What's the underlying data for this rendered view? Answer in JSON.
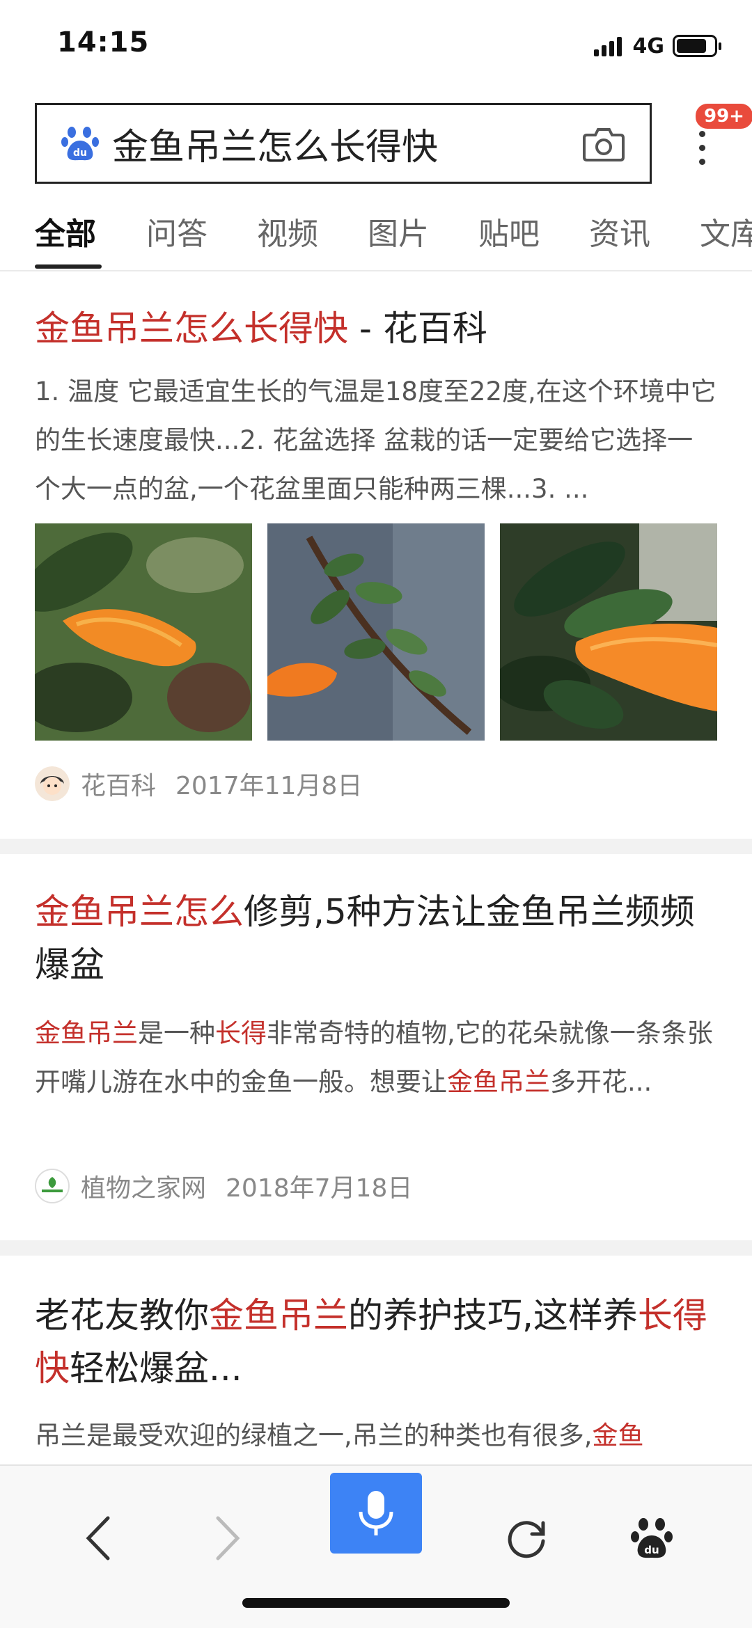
{
  "status": {
    "time": "14:15",
    "network": "4G"
  },
  "search": {
    "query": "金鱼吊兰怎么长得快",
    "badge": "99+"
  },
  "tabs": [
    {
      "label": "全部",
      "active": true
    },
    {
      "label": "问答"
    },
    {
      "label": "视频"
    },
    {
      "label": "图片"
    },
    {
      "label": "贴吧"
    },
    {
      "label": "资讯"
    },
    {
      "label": "文库"
    }
  ],
  "results": [
    {
      "title_hl": "金鱼吊兰怎么长得快",
      "title_rest": " - 花百科",
      "desc": "1. 温度 它最适宜生长的气温是18度至22度,在这个环境中它的生长速度最快...2. 花盆选择 盆栽的话一定要给它选择一个大一点的盆,一个花盆里面只能种两三棵...3. ...",
      "source": "花百科",
      "date": "2017年11月8日"
    },
    {
      "title_hl": "金鱼吊兰怎么",
      "title_rest": "修剪,5种方法让金鱼吊兰频频爆盆",
      "desc_parts": [
        "金鱼吊兰",
        "是一种",
        "长得",
        "非常奇特的植物,它的花朵就像一条条张开嘴儿游在水中的金鱼一般。想要让",
        "金鱼吊兰",
        "多开花..."
      ],
      "source": "植物之家网",
      "date": "2018年7月18日"
    },
    {
      "title_parts": [
        "老花友教你",
        "金鱼吊兰",
        "的养护技巧,这样养",
        "长得快",
        "轻松爆盆..."
      ],
      "desc_parts": [
        "吊兰是最受欢迎的绿植之一,吊兰的种类也有很多,",
        "金鱼"
      ]
    }
  ],
  "colors": {
    "highlight": "#c4302b",
    "mic_button": "#3d83f5",
    "badge": "#e94b3c"
  }
}
